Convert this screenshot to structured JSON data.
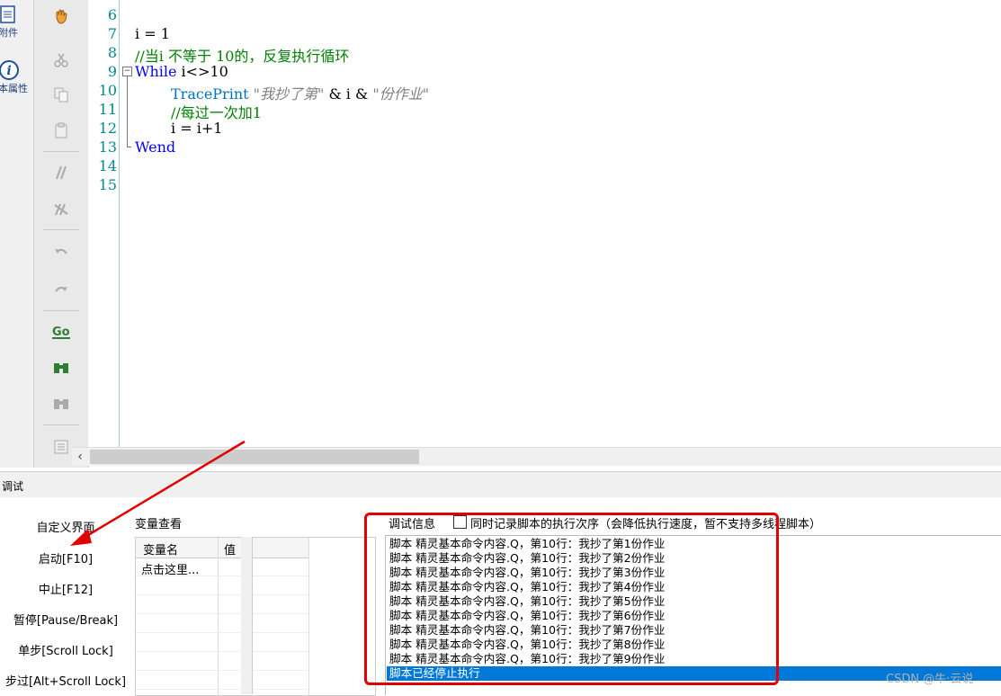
{
  "sidebar": {
    "items": [
      {
        "label": "附件",
        "icon": "document-icon"
      },
      {
        "label": "本属性",
        "icon": "info-icon"
      }
    ]
  },
  "toolbar": {
    "buttons": [
      "hand-icon",
      "cut-icon",
      "copy-icon",
      "paste-icon",
      "comment-icon",
      "uncomment-icon",
      "undo-icon",
      "redo-icon",
      "goto-icon",
      "find-icon",
      "replace-icon",
      "window-icon"
    ]
  },
  "editor": {
    "line_numbers": [
      "6",
      "7",
      "8",
      "9",
      "10",
      "11",
      "12",
      "13",
      "14",
      "15"
    ],
    "lines": {
      "l7": "i = 1",
      "l8": "//当i 不等于 10的，反复执行循环",
      "l9_kw": "While",
      "l9_rest": " i<>10",
      "l10_fn": "TracePrint",
      "l10_s1": " \"我抄了第\"",
      "l10_op": " & i & ",
      "l10_s2": "\"份作业\"",
      "l11": "//每过一次加1",
      "l12": "i = i+1",
      "l13": "Wend"
    }
  },
  "debug": {
    "title": "调试",
    "buttons": [
      "自定义界面",
      "启动[F10]",
      "中止[F12]",
      "暂停[Pause/Break]",
      "单步[Scroll Lock]",
      "步过[Alt+Scroll Lock]"
    ],
    "variables": {
      "title": "变量查看",
      "col_name": "变量名",
      "col_value": "值",
      "first_row": "点击这里..."
    },
    "info": {
      "title": "调试信息",
      "checkbox_label": "同时记录脚本的执行次序（会降低执行速度，暂不支持多线程脚本）",
      "log": [
        "脚本 精灵基本命令内容.Q，第10行：我抄了第1份作业",
        "脚本 精灵基本命令内容.Q，第10行：我抄了第2份作业",
        "脚本 精灵基本命令内容.Q，第10行：我抄了第3份作业",
        "脚本 精灵基本命令内容.Q，第10行：我抄了第4份作业",
        "脚本 精灵基本命令内容.Q，第10行：我抄了第5份作业",
        "脚本 精灵基本命令内容.Q，第10行：我抄了第6份作业",
        "脚本 精灵基本命令内容.Q，第10行：我抄了第7份作业",
        "脚本 精灵基本命令内容.Q，第10行：我抄了第8份作业",
        "脚本 精灵基本命令内容.Q，第10行：我抄了第9份作业",
        "脚本已经停止执行"
      ]
    }
  },
  "watermark": "CSDN @牛·云说",
  "colors": {
    "highlight": "#0078d7",
    "annotation": "#e00000",
    "keyword": "#0000ff",
    "comment": "#008000"
  }
}
